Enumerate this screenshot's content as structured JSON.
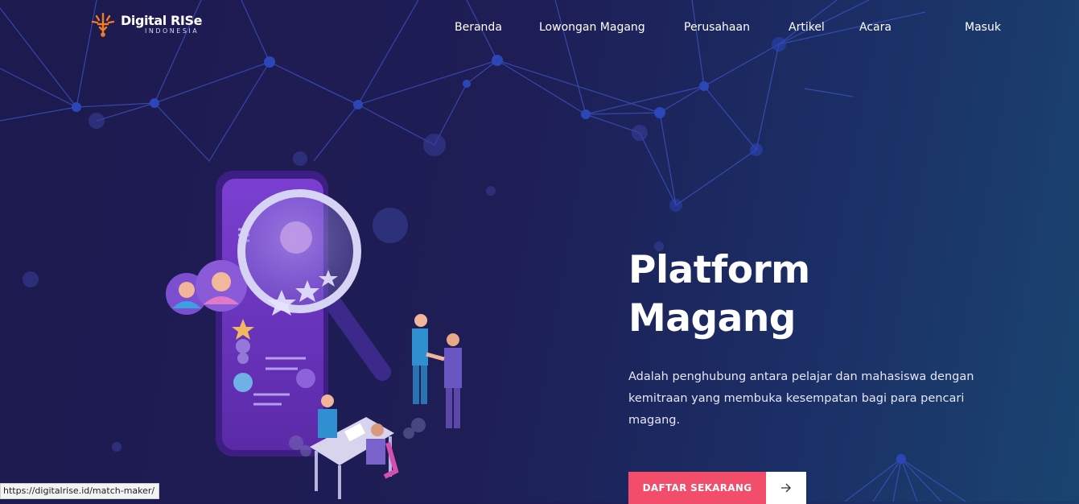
{
  "brand": {
    "name": "Digital RISe",
    "sub": "INDONESIA",
    "accent": "#f47b20"
  },
  "nav": {
    "items": [
      {
        "label": "Beranda"
      },
      {
        "label": "Lowongan Magang"
      },
      {
        "label": "Perusahaan"
      },
      {
        "label": "Artikel"
      },
      {
        "label": "Acara"
      }
    ],
    "login": "Masuk"
  },
  "hero": {
    "title_line1": "Platform",
    "title_line2": "Magang",
    "description": "Adalah penghubung antara pelajar dan mahasiswa dengan kemitraan yang membuka kesempatan bagi para pencari magang.",
    "cta_label": "DAFTAR SEKARANG",
    "cta_icon": "arrow-right-icon"
  },
  "status_bar": {
    "url": "https://digitalrise.id/match-maker/"
  },
  "colors": {
    "cta": "#f24e6b",
    "background": "#1e1d55",
    "network_line": "#3f5bd6"
  }
}
